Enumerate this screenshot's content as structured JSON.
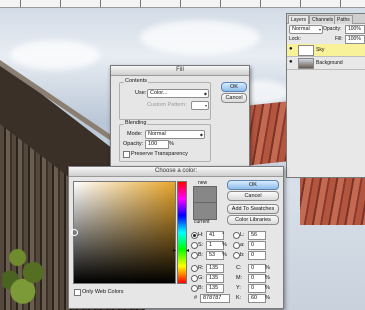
{
  "layers_panel": {
    "tabs": [
      "Layers",
      "Channels",
      "Paths"
    ],
    "blend_mode": "Normal",
    "opacity_label": "Opacity:",
    "opacity_value": "100%",
    "lock_label": "Lock:",
    "fill_label": "Fill:",
    "fill_value": "100%",
    "layers": [
      {
        "name": "Sky",
        "selected": true
      },
      {
        "name": "Background",
        "selected": false
      }
    ]
  },
  "fill_dialog": {
    "title": "Fill",
    "contents_label": "Contents",
    "use_label": "Use:",
    "use_value": "Color...",
    "custom_pattern_label": "Custom Pattern:",
    "blending_label": "Blending",
    "mode_label": "Mode:",
    "mode_value": "Normal",
    "opacity_label": "Opacity:",
    "opacity_value": "100",
    "opacity_unit": "%",
    "preserve_label": "Preserve Transparency",
    "ok_label": "OK",
    "cancel_label": "Cancel"
  },
  "color_picker": {
    "title": "Choose a color:",
    "new_label": "new",
    "current_label": "current",
    "ok_label": "OK",
    "cancel_label": "Cancel",
    "add_swatches_label": "Add To Swatches",
    "color_libraries_label": "Color Libraries",
    "only_web_label": "Only Web Colors",
    "fields": {
      "H": {
        "value": "41",
        "unit": "°"
      },
      "S": {
        "value": "1",
        "unit": "%"
      },
      "B": {
        "value": "53",
        "unit": "%"
      },
      "R": {
        "value": "135",
        "unit": ""
      },
      "G": {
        "value": "135",
        "unit": ""
      },
      "Bl": {
        "value": "135",
        "unit": ""
      },
      "L": {
        "value": "56",
        "unit": ""
      },
      "a": {
        "value": "0",
        "unit": ""
      },
      "b": {
        "value": "0",
        "unit": ""
      },
      "C": {
        "value": "0",
        "unit": "%"
      },
      "M": {
        "value": "0",
        "unit": "%"
      },
      "Y": {
        "value": "0",
        "unit": "%"
      },
      "K": {
        "value": "60",
        "unit": "%"
      }
    },
    "hex_label": "#",
    "hex_value": "878787",
    "colors": {
      "new_swatch": "#878787",
      "current_swatch": "#888888",
      "hue_accent": "#e8a62a"
    }
  }
}
